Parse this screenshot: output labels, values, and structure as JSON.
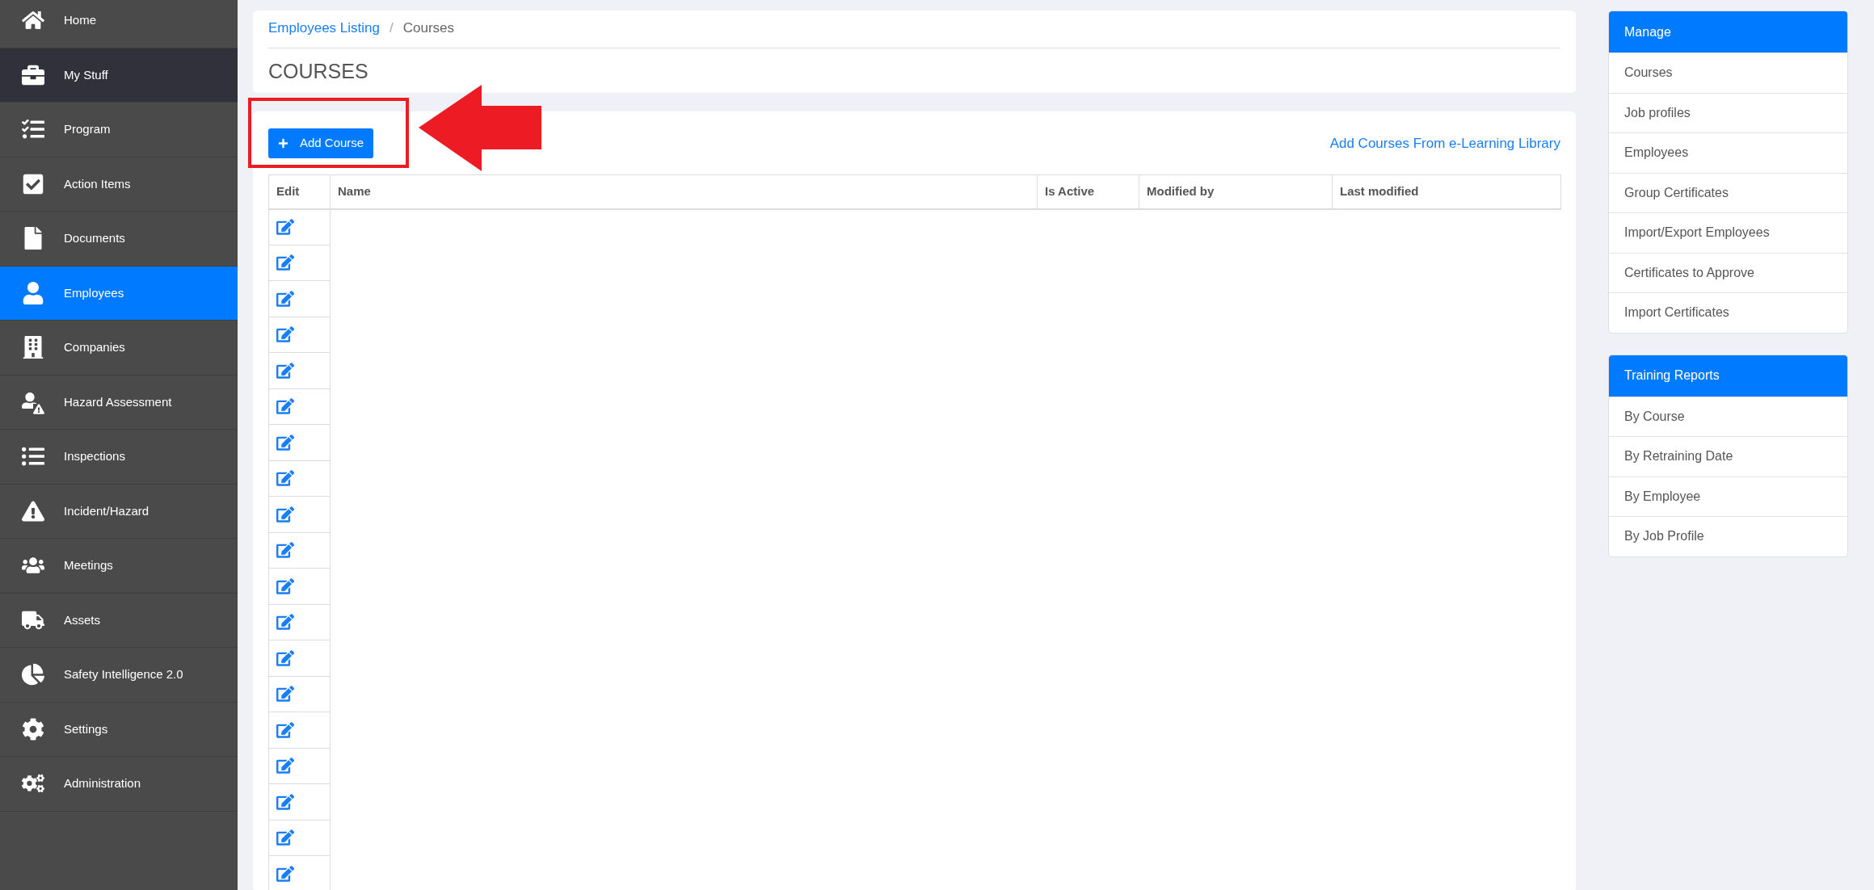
{
  "sidebar": {
    "items": [
      {
        "label": "Home",
        "selected": false,
        "highlighted": false
      },
      {
        "label": "My Stuff",
        "selected": false,
        "highlighted": true
      },
      {
        "label": "Program",
        "selected": false,
        "highlighted": false
      },
      {
        "label": "Action Items",
        "selected": false,
        "highlighted": false
      },
      {
        "label": "Documents",
        "selected": false,
        "highlighted": false
      },
      {
        "label": "Employees",
        "selected": true,
        "highlighted": false
      },
      {
        "label": "Companies",
        "selected": false,
        "highlighted": false
      },
      {
        "label": "Hazard Assessment",
        "selected": false,
        "highlighted": false
      },
      {
        "label": "Inspections",
        "selected": false,
        "highlighted": false
      },
      {
        "label": "Incident/Hazard",
        "selected": false,
        "highlighted": false
      },
      {
        "label": "Meetings",
        "selected": false,
        "highlighted": false
      },
      {
        "label": "Assets",
        "selected": false,
        "highlighted": false
      },
      {
        "label": "Safety Intelligence 2.0",
        "selected": false,
        "highlighted": false
      },
      {
        "label": "Settings",
        "selected": false,
        "highlighted": false
      },
      {
        "label": "Administration",
        "selected": false,
        "highlighted": false
      }
    ]
  },
  "breadcrumb_separator": "/",
  "breadcrumb": [
    {
      "label": "Employees Listing",
      "link": true
    },
    {
      "label": "Courses",
      "link": false
    }
  ],
  "page_title": "COURSES",
  "add_button": "Add Course",
  "library_link": "Add Courses From e-Learning Library",
  "table": {
    "columns": [
      "Edit",
      "Name",
      "Is Active",
      "Modified by",
      "Last modified"
    ],
    "rows": [
      {
        "editable": true
      },
      {
        "editable": true
      },
      {
        "editable": true
      },
      {
        "editable": true
      },
      {
        "editable": true
      },
      {
        "editable": true
      },
      {
        "editable": true
      },
      {
        "editable": true
      },
      {
        "editable": true
      },
      {
        "editable": true
      },
      {
        "editable": true
      },
      {
        "editable": true
      },
      {
        "editable": true
      },
      {
        "editable": true
      },
      {
        "editable": true
      },
      {
        "editable": true
      },
      {
        "editable": true
      },
      {
        "editable": true
      },
      {
        "editable": true
      }
    ]
  },
  "panels": [
    {
      "title": "Manage",
      "items": [
        "Courses",
        "Job profiles",
        "Employees",
        "Group Certificates",
        "Import/Export Employees",
        "Certificates to Approve",
        "Import Certificates"
      ]
    },
    {
      "title": "Training Reports",
      "items": [
        "By Course",
        "By Retraining Date",
        "By Employee",
        "By Job Profile"
      ]
    }
  ]
}
